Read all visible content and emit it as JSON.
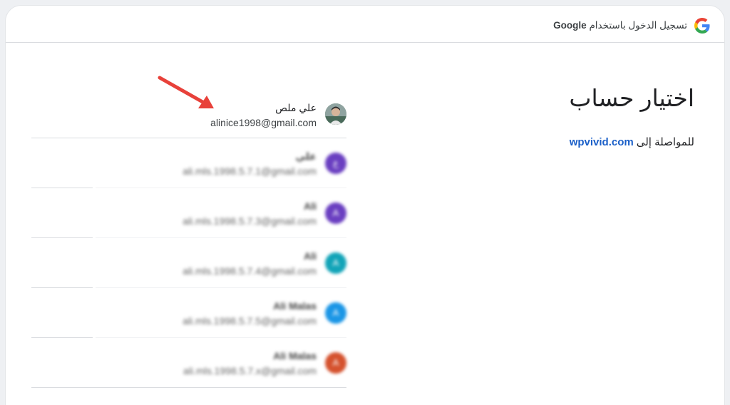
{
  "header": {
    "brand_prefix": "تسجيل الدخول باستخدام",
    "brand_name": "Google"
  },
  "main": {
    "title": "اختيار حساب",
    "continue_prefix": "للمواصلة إلى",
    "site": "wpvivid.com"
  },
  "accounts": [
    {
      "name": "علي ملص",
      "email": "alinice1998@gmail.com",
      "avatar_letter": "",
      "avatar_color": "#6b8e6e"
    },
    {
      "name": "علي",
      "email": "ali.mls.1998.5.7.1@gmail.com",
      "avatar_letter": "ع",
      "avatar_color": "#6a3fc1"
    },
    {
      "name": "Ali",
      "email": "ali.mls.1998.5.7.3@gmail.com",
      "avatar_letter": "A",
      "avatar_color": "#6a3fc1"
    },
    {
      "name": "Ali",
      "email": "ali.mls.1998.5.7.4@gmail.com",
      "avatar_letter": "A",
      "avatar_color": "#12a4b8"
    },
    {
      "name": "Ali Malas",
      "email": "ali.mls.1998.5.7.5@gmail.com",
      "avatar_letter": "A",
      "avatar_color": "#1b96e6"
    },
    {
      "name": "Ali Malas",
      "email": "ali.mls.1998.5.7.x@gmail.com",
      "avatar_letter": "A",
      "avatar_color": "#d5522e"
    }
  ],
  "colors": {
    "accent": "#1a5fc8",
    "arrow": "#e8413a"
  }
}
